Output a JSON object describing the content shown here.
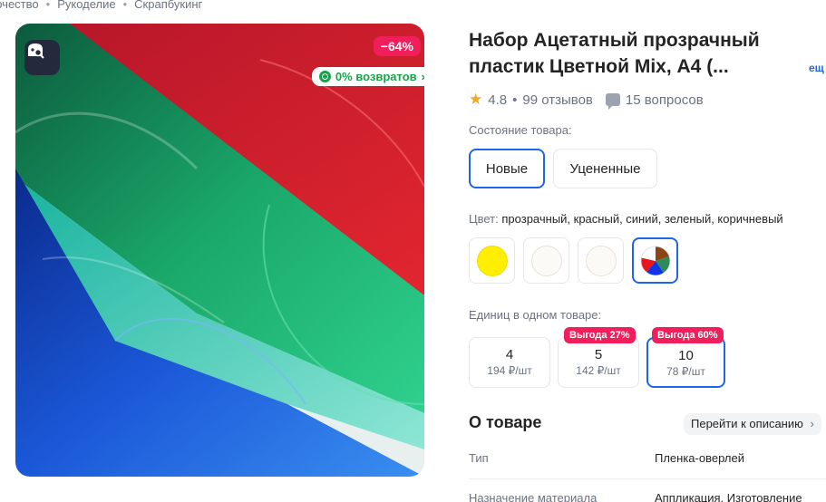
{
  "breadcrumb": [
    "орчество",
    "Рукоделие",
    "Скрапбукинг"
  ],
  "gallery": {
    "discount_badge": "−64%",
    "returns_badge": "0% возвратов",
    "returns_chevron": "›"
  },
  "product": {
    "title": "Набор Ацетатный прозрачный пластик Цветной Mix, А4 (...",
    "more_link": "ещ",
    "rating": "4.8",
    "rating_sep": "•",
    "reviews": "99 отзывов",
    "questions": "15 вопросов",
    "star": "★"
  },
  "condition": {
    "label": "Состояние товара:",
    "options": [
      "Новые",
      "Уцененные"
    ],
    "selected": 0
  },
  "color": {
    "label": "Цвет:",
    "value": "прозрачный, красный, синий, зеленый, коричневый",
    "swatches": [
      {
        "color": "#ffee00",
        "name": "yellow"
      },
      {
        "color": "#fbfaf7",
        "name": "off-white"
      },
      {
        "color": "#fbfaf7",
        "name": "off-white"
      },
      {
        "color": "multicolor",
        "name": "mix"
      }
    ],
    "selected": 3
  },
  "units": {
    "label": "Единиц в одном товаре:",
    "options": [
      {
        "count": "4",
        "price": "194 ₽/шт",
        "benefit": ""
      },
      {
        "count": "5",
        "price": "142 ₽/шт",
        "benefit": "Выгода 27%"
      },
      {
        "count": "10",
        "price": "78 ₽/шт",
        "benefit": "Выгода 60%"
      }
    ],
    "selected": 2
  },
  "about": {
    "title": "О товаре",
    "desc_link": "Перейти к описанию",
    "desc_chevron": "›",
    "specs": [
      {
        "key": "Тип",
        "value": "Пленка-оверлей"
      },
      {
        "key": "Назначение материала",
        "value": "Аппликация, Изготовление"
      }
    ]
  },
  "colors": {
    "accent": "#1e66e5",
    "badge": "#f01f5b",
    "green": "#17a34a",
    "star": "#f5a623"
  }
}
